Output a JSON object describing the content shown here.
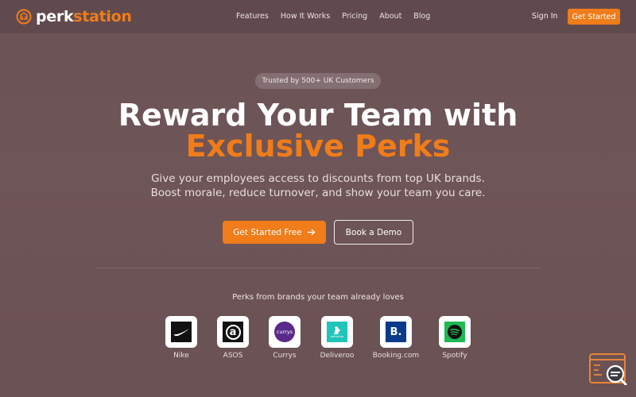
{
  "nav": {
    "brand_part1": "perk",
    "brand_part2": "station",
    "links": [
      "Features",
      "How It Works",
      "Pricing",
      "About",
      "Blog"
    ],
    "sign_in": "Sign In",
    "get_started": "Get Started"
  },
  "hero": {
    "badge": "Trusted by 500+ UK Customers",
    "title_line1": "Reward Your Team with",
    "title_line2": "Exclusive Perks",
    "subtitle_line1": "Give your employees access to discounts from top UK brands.",
    "subtitle_line2": "Boost morale, reduce turnover, and show your team you care.",
    "primary_cta": "Get Started Free",
    "secondary_cta": "Book a Demo"
  },
  "brands": {
    "title": "Perks from brands your team already loves",
    "items": [
      {
        "name": "Nike",
        "icon": "nike-logo-icon",
        "logo_text": ""
      },
      {
        "name": "ASOS",
        "icon": "asos-logo-icon",
        "logo_text": "a"
      },
      {
        "name": "Currys",
        "icon": "currys-logo-icon",
        "logo_text": "currys"
      },
      {
        "name": "Deliveroo",
        "icon": "deliveroo-logo-icon",
        "logo_text": "deliveroo"
      },
      {
        "name": "Booking.com",
        "icon": "booking-logo-icon",
        "logo_text": "B."
      },
      {
        "name": "Spotify",
        "icon": "spotify-logo-icon",
        "logo_text": ""
      }
    ]
  },
  "colors": {
    "accent": "#f07c1a",
    "background": "#6b5356"
  }
}
